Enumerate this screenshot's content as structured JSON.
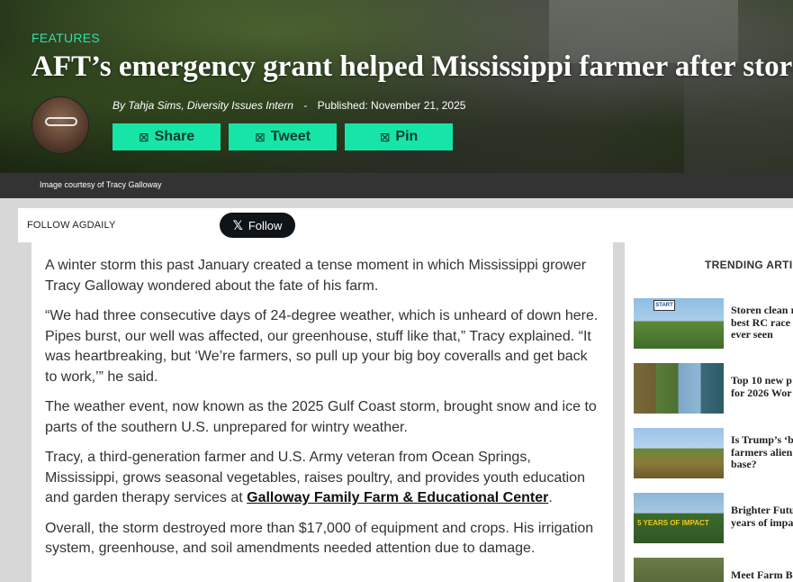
{
  "hero": {
    "category": "FEATURES",
    "headline": "AFT’s emergency grant helped Mississippi farmer after storm",
    "byline_author": "By Tahja Sims, Diversity Issues Intern",
    "byline_separator": "-",
    "published": "Published: November 21, 2025",
    "share_buttons": [
      {
        "label": "Share",
        "icon": "share-glyph"
      },
      {
        "label": "Tweet",
        "icon": "tweet-glyph"
      },
      {
        "label": "Pin",
        "icon": "pin-glyph"
      }
    ],
    "image_caption": "Image courtesy of Tracy Galloway"
  },
  "follow": {
    "label": "FOLLOW AGDAILY",
    "x_button_label": "Follow",
    "x_logo": "𝕏"
  },
  "article": {
    "p1": "A winter storm this past January created a tense moment in which Mississippi grower Tracy Galloway wondered about the fate of his farm.",
    "p2": "“We had three consecutive days of 24-degree weather, which is unheard of down here. Pipes burst, our well was affected, our greenhouse, stuff like that,” Tracy explained. “It was heartbreaking, but ‘We’re farmers, so pull up your big boy coveralls and get back to work,’” he said.",
    "p3": "The weather event, now known as the 2025 Gulf Coast storm, brought snow and ice to parts of the southern U.S. unprepared for wintry weather.",
    "p4_before": "Tracy, a third-generation farmer and U.S. Army veteran from Ocean Springs, Mississippi, grows seasonal vegetables, raises poultry, and provides youth education and garden therapy services at ",
    "p4_link": "Galloway Family Farm & Educational Center",
    "p4_after": ".",
    "p5": "Overall, the storm destroyed more than $17,000 of equipment and crops. His irrigation system, greenhouse, and soil amendments needed attention due to damage."
  },
  "sidebar": {
    "heading": "TRENDING ARTIC",
    "items": [
      {
        "title": "Storen clean r\nbest RC race\never seen",
        "thumb_text": "START"
      },
      {
        "title": "Top 10 new p\nfor 2026 Wor"
      },
      {
        "title": "Is Trump’s ‘b\nfarmers alien\nbase?"
      },
      {
        "title": "Brighter Futu\nyears of impa",
        "thumb_text": "5 YEARS OF IMPACT"
      },
      {
        "title": "Meet Farm B"
      }
    ]
  },
  "colors": {
    "accent": "#16e5a7",
    "category": "#2fe0a8",
    "caption_bar": "#333333",
    "page_bg": "#d7d7d7"
  }
}
